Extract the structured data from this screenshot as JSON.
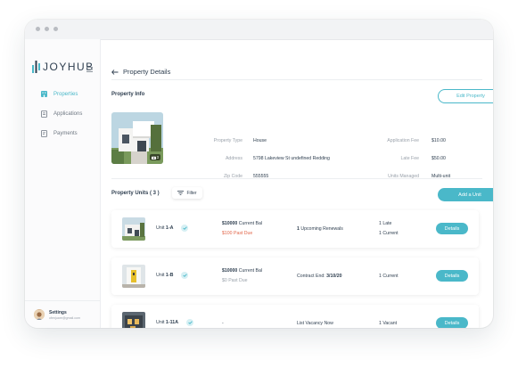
{
  "app": {
    "logo_text": "JOYHUB"
  },
  "sidebar": {
    "items": [
      {
        "label": "Properties",
        "icon": "building-icon",
        "active": true
      },
      {
        "label": "Applications",
        "icon": "document-icon",
        "active": false
      },
      {
        "label": "Payments",
        "icon": "receipt-icon",
        "active": false
      }
    ],
    "settings": {
      "title": "Settings",
      "email": "ofenjuare@gmail.com"
    }
  },
  "header": {
    "back_label": "Property Details"
  },
  "property_info": {
    "title": "Property Info",
    "edit_label": "Edit Property",
    "photo_count": "3",
    "fields_left": [
      {
        "label": "Property Type",
        "value": "House"
      },
      {
        "label": "Address",
        "value": "5798 Lakeview St undefined Redding"
      },
      {
        "label": "Zip Code",
        "value": "555555"
      }
    ],
    "fields_right": [
      {
        "label": "Application Fee",
        "value": "$10.00"
      },
      {
        "label": "Late Fee",
        "value": "$50.00"
      },
      {
        "label": "Units Managed",
        "value": "Multi-unit"
      }
    ]
  },
  "units": {
    "title": "Property Units ( 3 )",
    "filter_label": "Filter",
    "add_label": "Add a Unit",
    "details_label": "Details",
    "rows": [
      {
        "prefix": "Unit ",
        "id": "1-A",
        "balance_amount": "$10000",
        "balance_text": " Current Bal",
        "due_text": "$100 Past Due",
        "middle_bold": "1",
        "middle_text": " Upcoming Renewals",
        "status_line1": "1  Late",
        "status_line2": "1 Current"
      },
      {
        "prefix": "Unit ",
        "id": "1-B",
        "balance_amount": "$10000",
        "balance_text": " Current Bal",
        "due_text": "$0 Past Due",
        "middle_text": "Contract End: ",
        "middle_bold": "3/10/20",
        "status_line1": "1 Current"
      },
      {
        "prefix": "Unit ",
        "id": "1-11A",
        "balance_amount": "-",
        "middle_text": "List Vacancy Now",
        "status_line1": "1 Vacant"
      }
    ]
  },
  "colors": {
    "accent": "#4ab8c9",
    "past_due": "#e2664a",
    "text": "#2f3f50",
    "muted": "#9aa2ab"
  }
}
